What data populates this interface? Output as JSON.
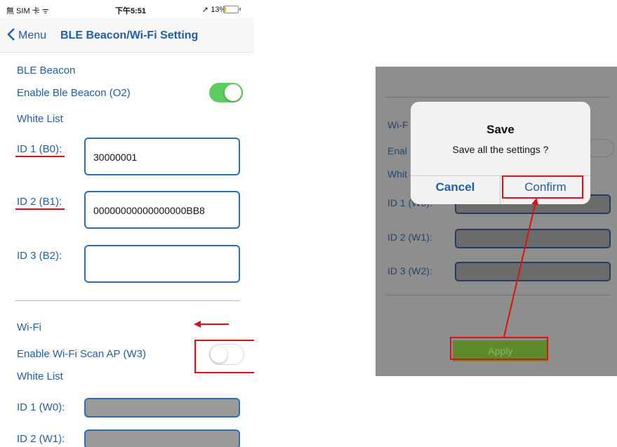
{
  "status_bar": {
    "carrier": "無 SIM 卡 ᯤ",
    "time": "下午5:51",
    "battery": "➚ 13%",
    "battery_level": 0.13
  },
  "nav": {
    "back": "Menu",
    "title": "BLE Beacon/Wi-Fi Setting"
  },
  "ble": {
    "section": "BLE Beacon",
    "enable_label": "Enable Ble Beacon (O2)",
    "enabled": true,
    "whitelist_label": "White List",
    "ids": [
      {
        "label": "ID 1 (B0):",
        "value": "30000001"
      },
      {
        "label": "ID 2 (B1):",
        "value": "00000000000000000BB8"
      },
      {
        "label": "ID 3 (B2):",
        "value": ""
      }
    ]
  },
  "wifi": {
    "section": "Wi-Fi",
    "enable_label": "Enable Wi-Fi Scan AP (W3)",
    "enabled": false,
    "whitelist_label": "White List",
    "ids": [
      {
        "label": "ID 1 (W0):"
      },
      {
        "label": "ID 2 (W1):"
      }
    ]
  },
  "right_screen": {
    "partial_labels": [
      "Wi-F",
      "Enal",
      "Whit"
    ],
    "id1_label": "ID 1 (W0):",
    "id2_label": "ID 2 (W1):",
    "id3_label": "ID 3 (W2):",
    "apply": "Apply"
  },
  "dialog": {
    "title": "Save",
    "message": "Save all the settings ?",
    "cancel": "Cancel",
    "confirm": "Confirm"
  },
  "annotation_color": "#e01010"
}
